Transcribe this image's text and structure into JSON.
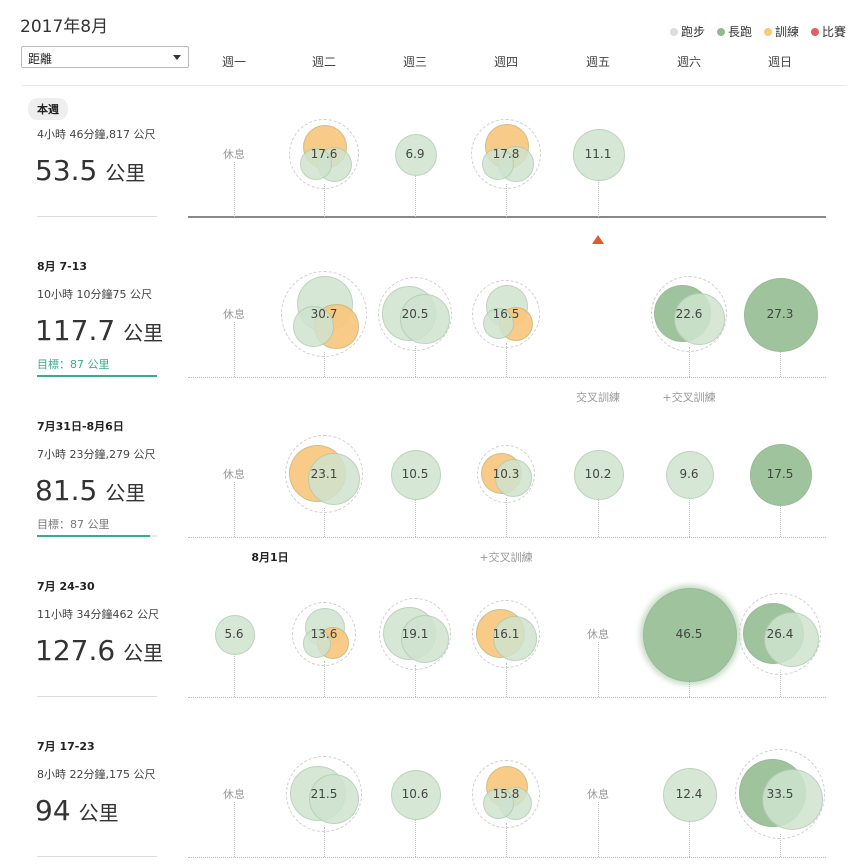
{
  "header": {
    "title": "2017年8月",
    "metric_selected": "距離"
  },
  "legend": [
    {
      "label": "跑步",
      "color": "#dddddd"
    },
    {
      "label": "長跑",
      "color": "#8fbc8f"
    },
    {
      "label": "訓練",
      "color": "#f9c77e"
    },
    {
      "label": "比賽",
      "color": "#e06060"
    }
  ],
  "colors": {
    "easy": "#cfe3cf",
    "long": "#8fb98c",
    "workout": "#f9c77e",
    "goal": "#3aaa8a"
  },
  "days": [
    "週一",
    "週二",
    "週三",
    "週四",
    "週五",
    "週六",
    "週日"
  ],
  "rest_label": "休息",
  "weeks": [
    {
      "label": "本週",
      "is_current": true,
      "stats": "4小時 46分鐘,817 公尺",
      "total": "53.5",
      "unit": "公里",
      "days": [
        {
          "rest": true
        },
        {
          "value": "17.6",
          "km": 17.6,
          "parts": [
            "workout",
            "easy",
            "easy"
          ]
        },
        {
          "value": "6.9",
          "km": 6.9,
          "parts": [
            "easy"
          ]
        },
        {
          "value": "17.8",
          "km": 17.8,
          "parts": [
            "workout",
            "easy",
            "easy"
          ]
        },
        {
          "value": "11.1",
          "km": 11.1,
          "parts": [
            "easy"
          ]
        },
        null,
        null
      ]
    },
    {
      "label": "8月 7-13",
      "stats": "10小時 10分鐘75 公尺",
      "total": "117.7",
      "unit": "公里",
      "goal": "目標：87 公里",
      "goal_progress": 1.0,
      "days": [
        {
          "rest": true
        },
        {
          "value": "30.7",
          "km": 30.7,
          "parts": [
            "easy",
            "workout",
            "easy"
          ]
        },
        {
          "value": "20.5",
          "km": 20.5,
          "parts": [
            "easy",
            "easy"
          ]
        },
        {
          "value": "16.5",
          "km": 16.5,
          "parts": [
            "easy",
            "workout",
            "easy"
          ]
        },
        null,
        {
          "value": "22.6",
          "km": 22.6,
          "parts": [
            "long",
            "easy"
          ]
        },
        {
          "value": "27.3",
          "km": 27.3,
          "parts": [
            "long"
          ]
        }
      ],
      "notes": [
        {
          "day": 4,
          "text": "交叉訓練"
        },
        {
          "day": 5,
          "text": "+交叉訓練"
        }
      ]
    },
    {
      "label": "7月31日-8月6日",
      "stats": "7小時 23分鐘,279 公尺",
      "total": "81.5",
      "unit": "公里",
      "goal": "目標：87 公里",
      "goal_progress": 0.94,
      "days": [
        {
          "rest": true
        },
        {
          "value": "23.1",
          "km": 23.1,
          "parts": [
            "workout",
            "easy"
          ]
        },
        {
          "value": "10.5",
          "km": 10.5,
          "parts": [
            "easy"
          ]
        },
        {
          "value": "10.3",
          "km": 10.3,
          "parts": [
            "workout",
            "easy"
          ]
        },
        {
          "value": "10.2",
          "km": 10.2,
          "parts": [
            "easy"
          ]
        },
        {
          "value": "9.6",
          "km": 9.6,
          "parts": [
            "easy"
          ]
        },
        {
          "value": "17.5",
          "km": 17.5,
          "parts": [
            "long"
          ]
        }
      ],
      "notes": [
        {
          "day": 0.5,
          "text": "8月1日",
          "bold": true
        },
        {
          "day": 3,
          "text": "+交叉訓練"
        }
      ]
    },
    {
      "label": "7月 24-30",
      "stats": "11小時 34分鐘462 公尺",
      "total": "127.6",
      "unit": "公里",
      "days": [
        {
          "value": "5.6",
          "km": 5.6,
          "parts": [
            "easy"
          ]
        },
        {
          "value": "13.6",
          "km": 13.6,
          "parts": [
            "easy",
            "workout",
            "easy"
          ]
        },
        {
          "value": "19.1",
          "km": 19.1,
          "parts": [
            "easy",
            "easy"
          ]
        },
        {
          "value": "16.1",
          "km": 16.1,
          "parts": [
            "workout",
            "easy"
          ]
        },
        {
          "rest": true
        },
        {
          "value": "46.5",
          "km": 46.5,
          "parts": [
            "long"
          ]
        },
        {
          "value": "26.4",
          "km": 26.4,
          "parts": [
            "long",
            "easy"
          ]
        }
      ]
    },
    {
      "label": "7月 17-23",
      "stats": "8小時 22分鐘,175 公尺",
      "total": "94",
      "unit": "公里",
      "days": [
        {
          "rest": true
        },
        {
          "value": "21.5",
          "km": 21.5,
          "parts": [
            "easy",
            "easy"
          ]
        },
        {
          "value": "10.6",
          "km": 10.6,
          "parts": [
            "easy"
          ]
        },
        {
          "value": "15.8",
          "km": 15.8,
          "parts": [
            "workout",
            "easy",
            "easy"
          ]
        },
        {
          "rest": true
        },
        {
          "value": "12.4",
          "km": 12.4,
          "parts": [
            "easy"
          ]
        },
        {
          "value": "33.5",
          "km": 33.5,
          "parts": [
            "long",
            "easy"
          ]
        }
      ]
    }
  ]
}
